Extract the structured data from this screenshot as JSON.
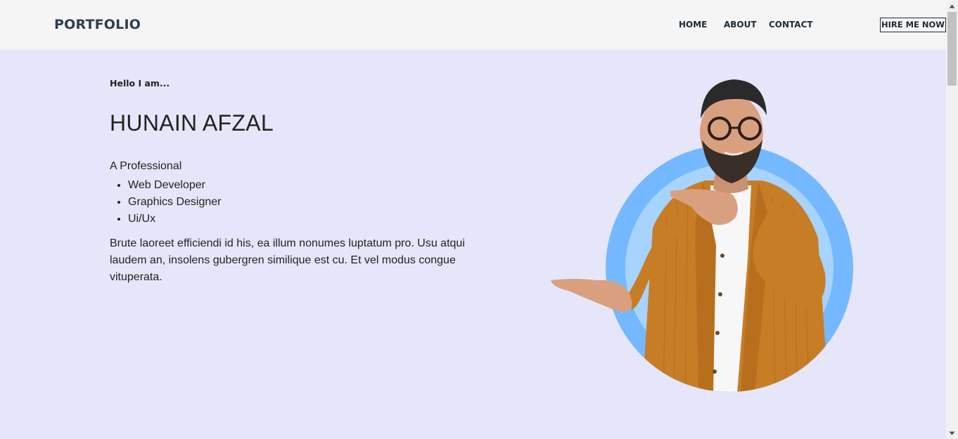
{
  "navbar": {
    "brand": "PORTFOLIO",
    "links": [
      "HOME",
      "ABOUT",
      "CONTACT"
    ],
    "cta": "HIRE ME NOW"
  },
  "hero": {
    "greeting": "Hello I am...",
    "name": "HUNAIN AFZAL",
    "tagline": "A Professional",
    "roles": [
      "Web Developer",
      "Graphics Designer",
      "Ui/Ux"
    ],
    "bio": "Brute laoreet efficiendi id his, ea illum nonumes luptatum pro. Usu atqui laudem an, insolens gubergren similique est cu. Et vel modus congue vituperata."
  },
  "colors": {
    "page_bg": "#e6e6fa",
    "navbar_bg": "#f5f5f5",
    "circle_outer": "#74b9ff",
    "circle_inner": "#a7d3ff",
    "jacket": "#c77d26"
  },
  "icons": {
    "scroll_up": "triangle-up-icon",
    "scroll_down": "triangle-down-icon"
  }
}
